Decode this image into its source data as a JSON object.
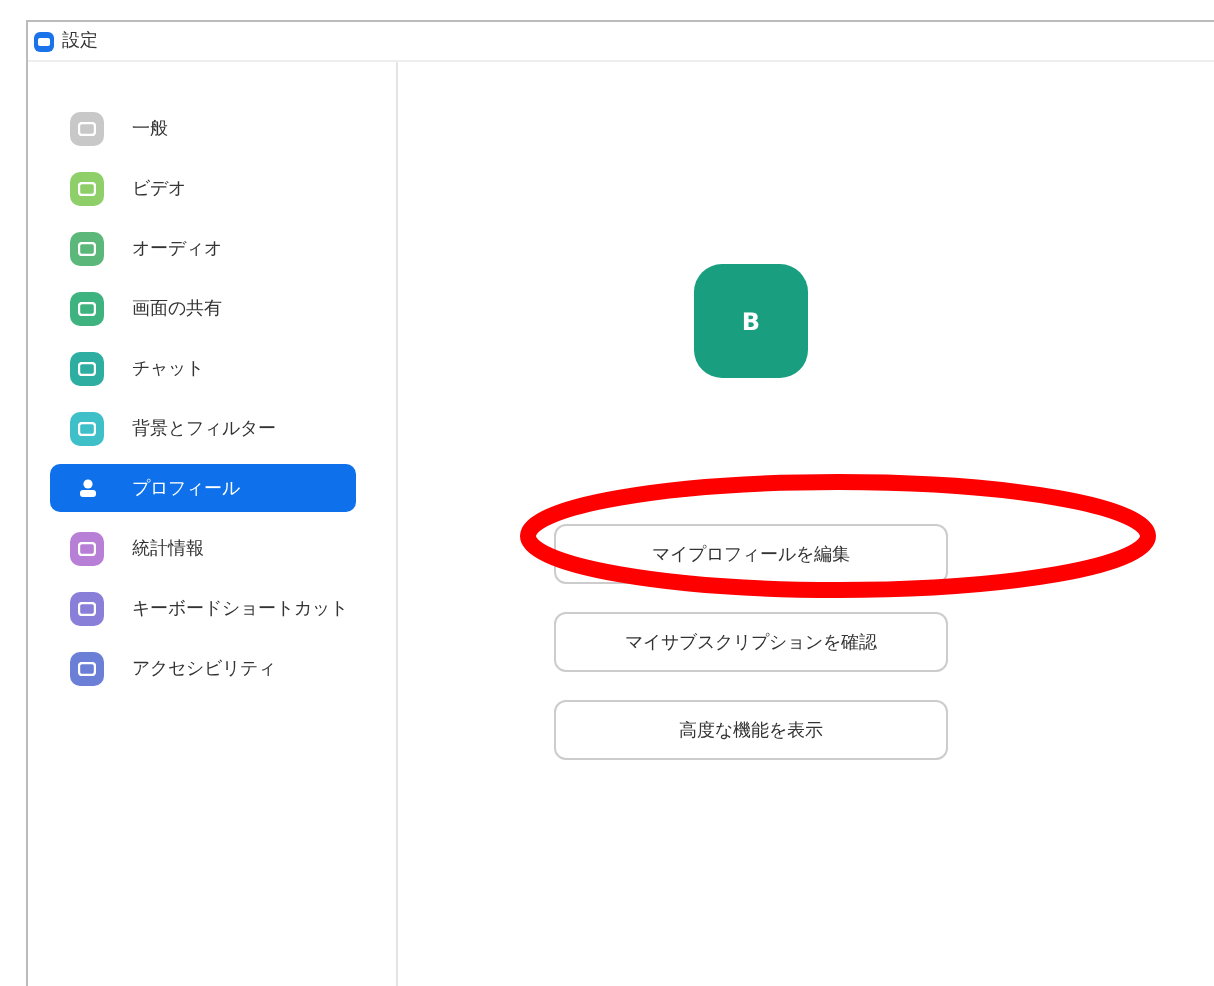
{
  "window": {
    "title": "設定"
  },
  "sidebar": {
    "items": [
      {
        "label": "一般",
        "color": "#c8c8c8",
        "selected": false
      },
      {
        "label": "ビデオ",
        "color": "#8fcf6a",
        "selected": false
      },
      {
        "label": "オーディオ",
        "color": "#5cb87a",
        "selected": false
      },
      {
        "label": "画面の共有",
        "color": "#3fb37f",
        "selected": false
      },
      {
        "label": "チャット",
        "color": "#2eaea0",
        "selected": false
      },
      {
        "label": "背景とフィルター",
        "color": "#3fc0c8",
        "selected": false
      },
      {
        "label": "プロフィール",
        "color": "#0e71eb",
        "selected": true
      },
      {
        "label": "統計情報",
        "color": "#b77fd6",
        "selected": false
      },
      {
        "label": "キーボードショートカット",
        "color": "#8a7fd8",
        "selected": false
      },
      {
        "label": "アクセシビリティ",
        "color": "#6b7fd6",
        "selected": false
      }
    ]
  },
  "profile": {
    "avatar_initial": "B",
    "buttons": [
      "マイプロフィールを編集",
      "マイサブスクリプションを確認",
      "高度な機能を表示"
    ]
  },
  "annotation": {
    "kind": "ellipse"
  }
}
